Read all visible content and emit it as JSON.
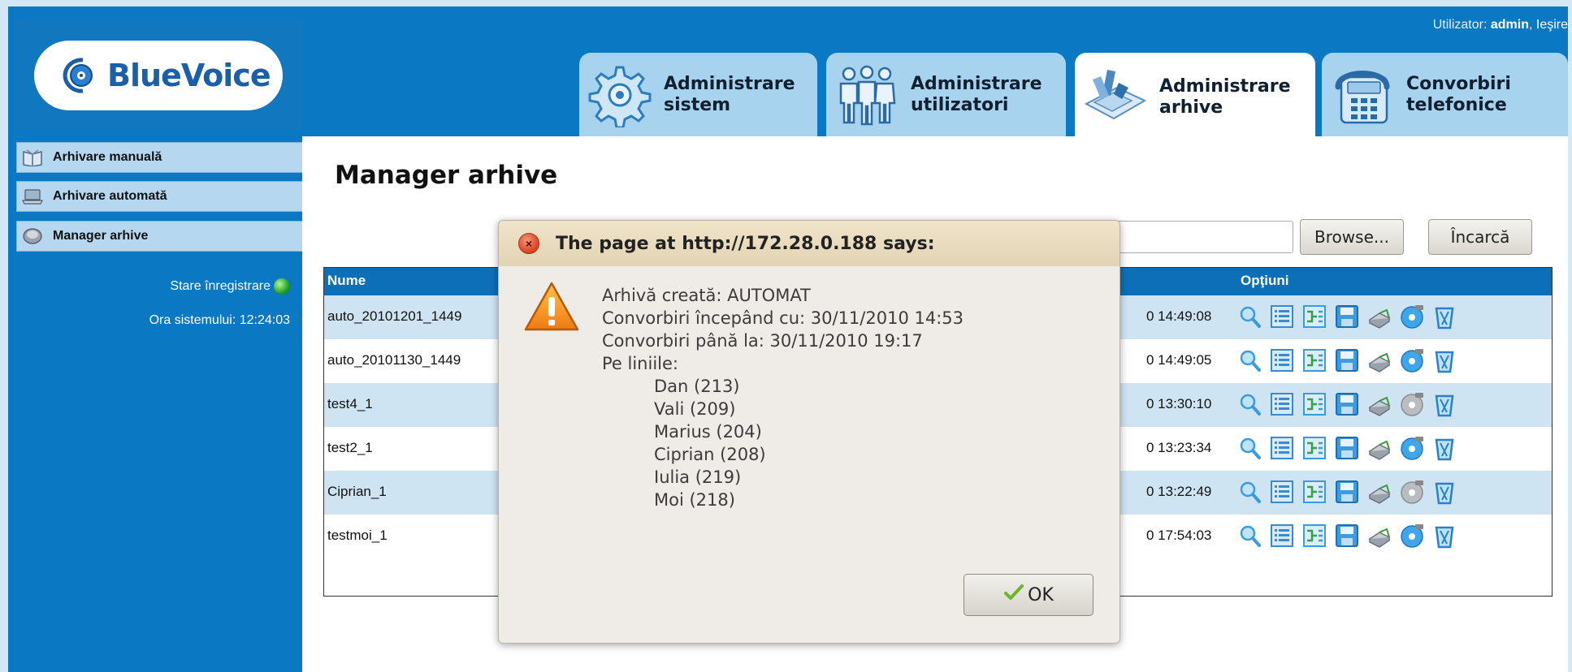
{
  "brand": {
    "logo_text_blue": "Blue",
    "logo_text_voice": "Voice"
  },
  "user": {
    "prefix": "Utilizator: ",
    "name": "admin",
    "separator": ", ",
    "logout": "Ieşire"
  },
  "tabs": [
    {
      "line1": "Administrare",
      "line2": "sistem",
      "icon": "gear-icon",
      "active": false
    },
    {
      "line1": "Administrare",
      "line2": "utilizatori",
      "icon": "users-icon",
      "active": false
    },
    {
      "line1": "Administrare",
      "line2": "arhive",
      "icon": "archive-icon",
      "active": true
    },
    {
      "line1": "Convorbiri",
      "line2": "telefonice",
      "icon": "telephone-icon",
      "active": false
    }
  ],
  "sidebar": {
    "items": [
      {
        "label": "Arhivare manuală",
        "icon": "book-icon"
      },
      {
        "label": "Arhivare automată",
        "icon": "laptop-icon"
      },
      {
        "label": "Manager arhive",
        "icon": "hdd-icon"
      }
    ],
    "status_label": "Stare înregistrare",
    "time_label": "Ora sistemului: 12:24:03"
  },
  "main": {
    "title": "Manager arhive",
    "browse_label": "Browse...",
    "upload_label": "Încarcă",
    "columns": {
      "name": "Nume",
      "options": "Opţiuni"
    },
    "rows": [
      {
        "name": "auto_20101201_1449",
        "date": "0 14:49:08",
        "cd_active": true
      },
      {
        "name": "auto_20101130_1449",
        "date": "0 14:49:05",
        "cd_active": true
      },
      {
        "name": "test4_1",
        "date": "0 13:30:10",
        "cd_active": false
      },
      {
        "name": "test2_1",
        "date": "0 13:23:34",
        "cd_active": true
      },
      {
        "name": "Ciprian_1",
        "date": "0 13:22:49",
        "cd_active": false
      },
      {
        "name": "testmoi_1",
        "date": "0 17:54:03",
        "cd_active": true
      }
    ]
  },
  "dialog": {
    "title": "The page at http://172.28.0.188 says:",
    "lines": [
      "Arhivă creată: AUTOMAT",
      "Convorbiri începând cu: 30/11/2010 14:53",
      "Convorbiri până la: 30/11/2010 19:17",
      "Pe liniile:"
    ],
    "lines_list": [
      "Dan (213)",
      "Vali (209)",
      "Marius (204)",
      "Ciprian (208)",
      "Iulia (219)",
      "Moi (218)"
    ],
    "ok_label": "OK"
  }
}
